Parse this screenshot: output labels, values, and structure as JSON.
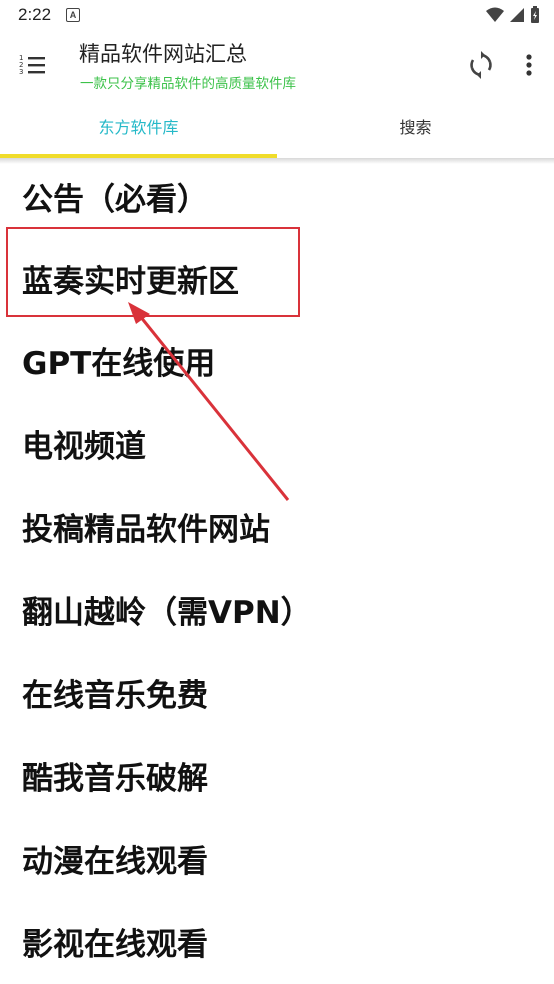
{
  "status_bar": {
    "time": "2:22",
    "notif_badge": "A"
  },
  "app_bar": {
    "title": "精品软件网站汇总",
    "subtitle": "一款只分享精品软件的高质量软件库"
  },
  "tabs": [
    {
      "label": "东方软件库",
      "active": true
    },
    {
      "label": "搜索",
      "active": false
    }
  ],
  "list": [
    "公告（必看）",
    "蓝奏实时更新区",
    "GPT在线使用",
    "电视频道",
    "投稿精品软件网站",
    "翻山越岭（需VPN）",
    "在线音乐免费",
    "酷我音乐破解",
    "动漫在线观看",
    "影视在线观看"
  ],
  "colors": {
    "accent_tab": "#25b9c8",
    "indicator": "#f0dc2a",
    "subtitle": "#3cc24a",
    "annotation": "#d9323a"
  }
}
